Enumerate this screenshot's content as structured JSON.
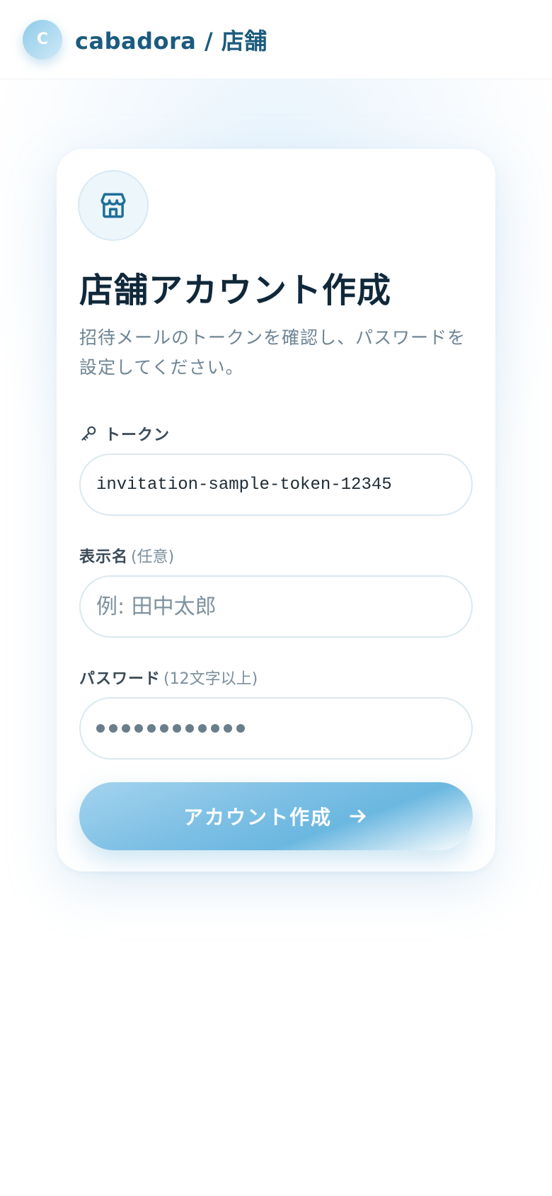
{
  "header": {
    "logo_letter": "C",
    "brand": "cabadora / 店舗"
  },
  "card": {
    "title": "店舗アカウント作成",
    "description": "招待メールのトークンを確認し、パスワードを設定してください。",
    "token": {
      "label": "トークン",
      "value": "invitation-sample-token-12345",
      "icon": "key-icon"
    },
    "display_name": {
      "label": "表示名",
      "hint": "(任意)",
      "placeholder": "例: 田中太郎"
    },
    "password": {
      "label": "パスワード",
      "hint": "(12文字以上)",
      "masked_length": 12
    },
    "submit": {
      "label": "アカウント作成",
      "icon": "arrow-right-icon"
    },
    "badge_icon": "store-icon"
  },
  "colors": {
    "brand": "#1b5b7e",
    "title": "#10283a",
    "button_blue": "#7fc0e5"
  }
}
